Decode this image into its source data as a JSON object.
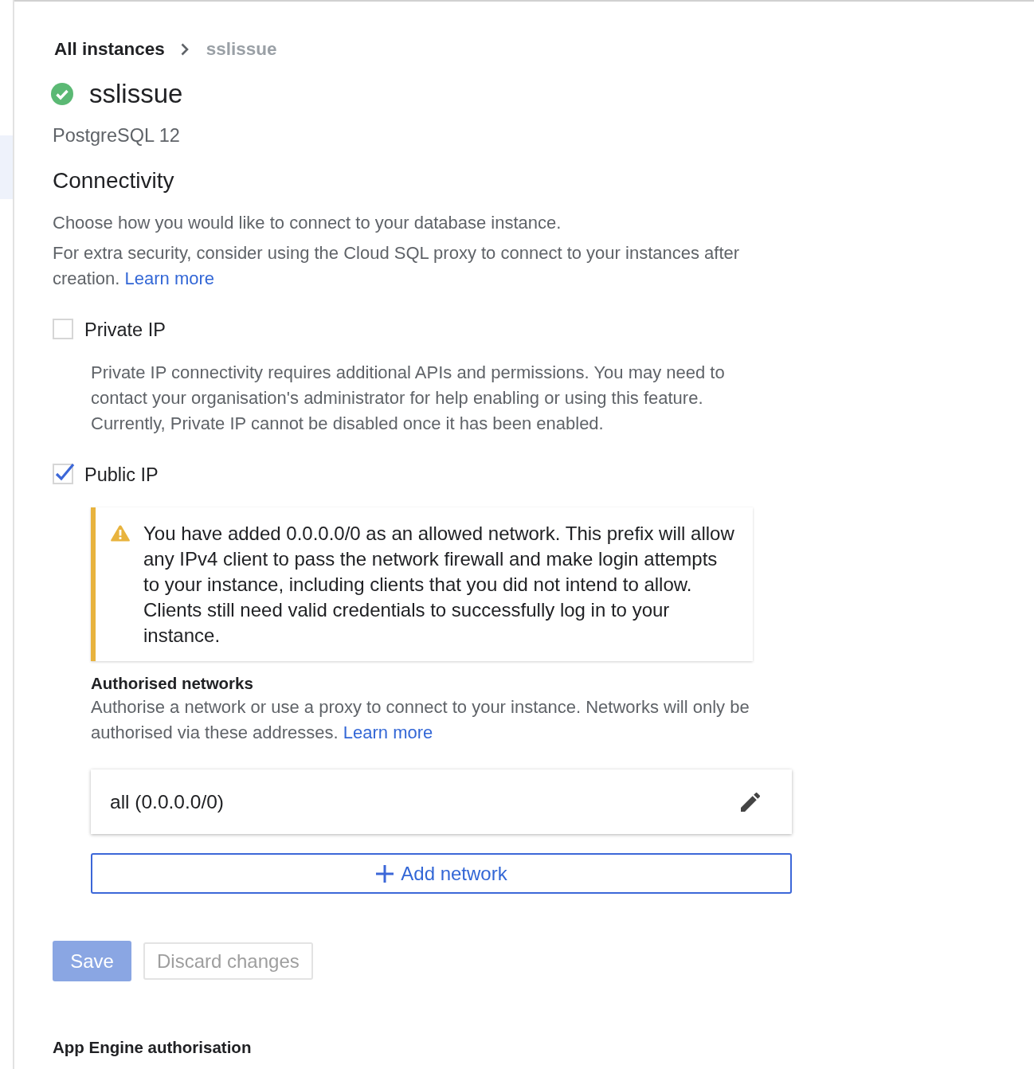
{
  "breadcrumb": {
    "parent": "All instances",
    "current": "sslissue"
  },
  "instance": {
    "name": "sslissue",
    "healthy": true,
    "version": "PostgreSQL 12"
  },
  "section": {
    "title": "Connectivity",
    "intro": "Choose how you would like to connect to your database instance.",
    "note": "For extra security, consider using the Cloud SQL proxy to connect to your instances after creation.",
    "note_link": "Learn more"
  },
  "options": [
    {
      "label": "Private IP",
      "checked": false,
      "description": "Private IP connectivity requires additional APIs and permissions. You may need to contact your organisation's administrator for help enabling or using this feature. Currently, Private IP cannot be disabled once it has been enabled."
    },
    {
      "label": "Public IP",
      "checked": true,
      "warning": "You have added 0.0.0.0/0 as an allowed network. This prefix will allow any IPv4 client to pass the network firewall and make login attempts to your instance, including clients that you did not intend to allow. Clients still need valid credentials to successfully log in to your instance.",
      "authorised": {
        "title": "Authorised networks",
        "text": "Authorise a network or use a proxy to connect to your instance. Networks will only be authorised via these addresses.",
        "link": "Learn more",
        "networks": [
          "all (0.0.0.0/0)"
        ],
        "add_button": "Add network"
      }
    }
  ],
  "actions": [
    {
      "label": "Save",
      "kind": "primary",
      "disabled": true
    },
    {
      "label": "Discard changes",
      "kind": "secondary",
      "disabled": true
    }
  ],
  "next_section": {
    "title": "App Engine authorisation"
  }
}
